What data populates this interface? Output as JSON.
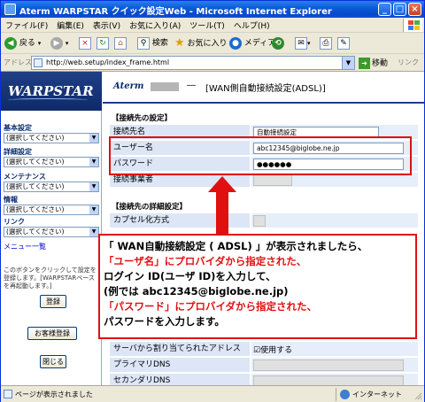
{
  "window": {
    "title": "Aterm WARPSTAR クイック設定Web - Microsoft Internet Explorer",
    "min_label": "_",
    "max_label": "□",
    "close_label": "×"
  },
  "menu": [
    "ファイル(F)",
    "編集(E)",
    "表示(V)",
    "お気に入り(A)",
    "ツール(T)",
    "ヘルプ(H)"
  ],
  "toolbar": {
    "back_label": "戻る",
    "search_label": "検索",
    "favorites_label": "お気に入り",
    "media_label": "メディア"
  },
  "address": {
    "label": "アドレス(D)",
    "url": "http://web.setup/index_frame.html",
    "go_label": "移動",
    "links_label": "リンク"
  },
  "sidebar": {
    "logo_text": "WARPSTAR",
    "groups": [
      {
        "heading": "基本設定",
        "selected": "(選択してください)"
      },
      {
        "heading": "詳細設定",
        "selected": "(選択してください)"
      },
      {
        "heading": "メンテナンス",
        "selected": "(選択してください)"
      },
      {
        "heading": "情報",
        "selected": "(選択してください)"
      },
      {
        "heading": "リンク",
        "selected": "(選択してください)"
      }
    ],
    "menu_list_label": "メニュー一覧",
    "note": "このボタンをクリックして設定を登録します。[WARPSTARベースを再起動します。]",
    "register_label": "登録",
    "favorites_register_label": "お客様登録",
    "close_label": "閉じる"
  },
  "main": {
    "brand": "Aterm",
    "page_title": "[WAN側自動接続設定(ADSL)]",
    "section1": "【接続先の設定】",
    "section2": "【接続先の詳細設定】",
    "rows1": [
      {
        "label": "接続先名",
        "value": "自動接続設定"
      },
      {
        "label": "ユーザー名",
        "value": "abc12345@biglobe.ne.jp"
      },
      {
        "label": "パスワード",
        "value": "●●●●●●"
      },
      {
        "label": "接続事業者",
        "value": ""
      }
    ],
    "rows2": [
      {
        "label": "カプセル化方式",
        "value": ""
      }
    ],
    "rows3": [
      {
        "label": "サーバから割り当てられたアドレス",
        "value": "☑使用する"
      },
      {
        "label": "プライマリDNS",
        "value": ""
      },
      {
        "label": "セカンダリDNS",
        "value": ""
      }
    ]
  },
  "callout": {
    "line1": "「 WAN自動接続設定 ( ADSL) 」が表示されましたら、",
    "line2": "「ユーザ名」にプロバイダから指定された、",
    "line3": "ログイン ID(ユーザ ID)を入力して、",
    "line4": "(例では abc12345@biglobe.ne.jp)",
    "line5": "「パスワード」にプロバイダから指定された、",
    "line6": "パスワードを入力します。"
  },
  "status": {
    "text": "ページが表示されました",
    "zone": "インターネット"
  },
  "colors": {
    "highlight": "#e01010",
    "titlebar": "#0a5ad6",
    "label_bg": "#dce6f6"
  }
}
